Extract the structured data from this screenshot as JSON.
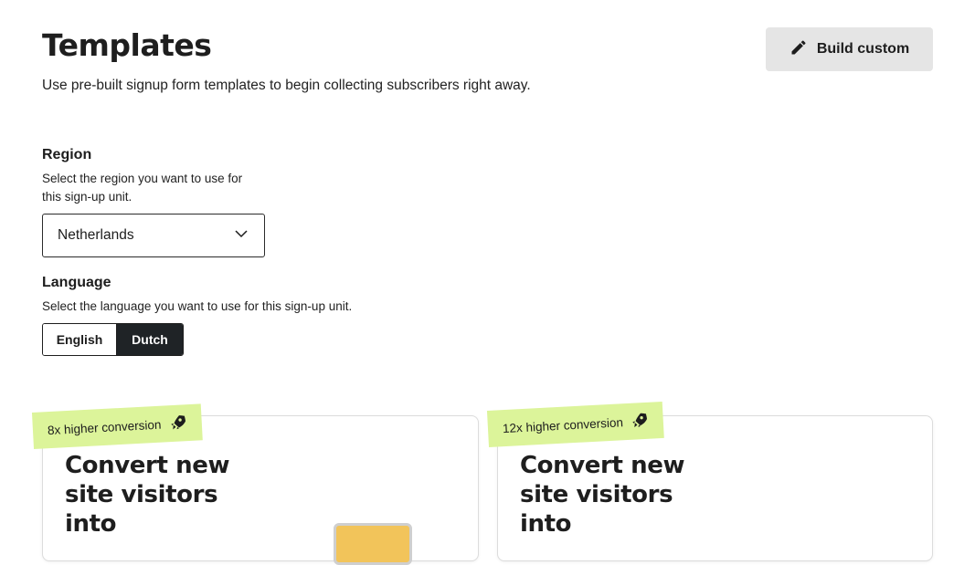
{
  "header": {
    "title": "Templates",
    "subtitle": "Use pre-built signup form templates to begin collecting subscribers right away.",
    "build_button": {
      "label": "Build custom",
      "icon": "pencil-icon"
    }
  },
  "region": {
    "label": "Region",
    "help_line1": "Select the region you want to use for",
    "help_line2": "this sign-up unit.",
    "selected": "Netherlands",
    "icon": "chevron-down-icon"
  },
  "language": {
    "label": "Language",
    "help": "Select the language you want to use for this sign-up unit.",
    "options": [
      "English",
      "Dutch"
    ],
    "selected": "Dutch"
  },
  "cards": [
    {
      "badge": "8x higher conversion",
      "badge_icon": "rocket-icon",
      "title_line1": "Convert new",
      "title_line2": "site visitors",
      "title_line3": "into"
    },
    {
      "badge": "12x higher conversion",
      "badge_icon": "rocket-icon",
      "title_line1": "Convert new",
      "title_line2": "site visitors",
      "title_line3": "into"
    }
  ],
  "colors": {
    "badge_bg": "#dcf49a",
    "selected_segment_bg": "#1f2326",
    "build_button_bg": "#e5e5e5",
    "preview_accent": "#f2c45a"
  }
}
